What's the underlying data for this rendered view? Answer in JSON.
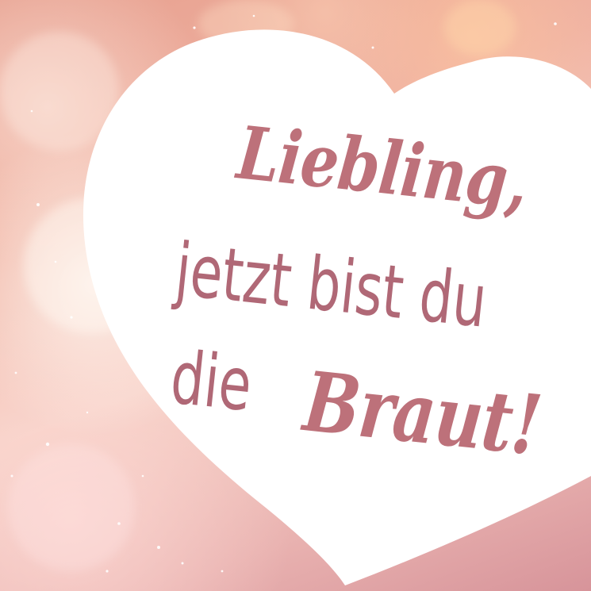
{
  "heart_text": {
    "line1": "Liebling,",
    "line2": "jetzt bist du",
    "line3_plain": "die",
    "line3_script": "Braut!"
  },
  "colors": {
    "heart": "#ffffff",
    "text": "#b76d7a",
    "background": "#eeb5a6"
  }
}
